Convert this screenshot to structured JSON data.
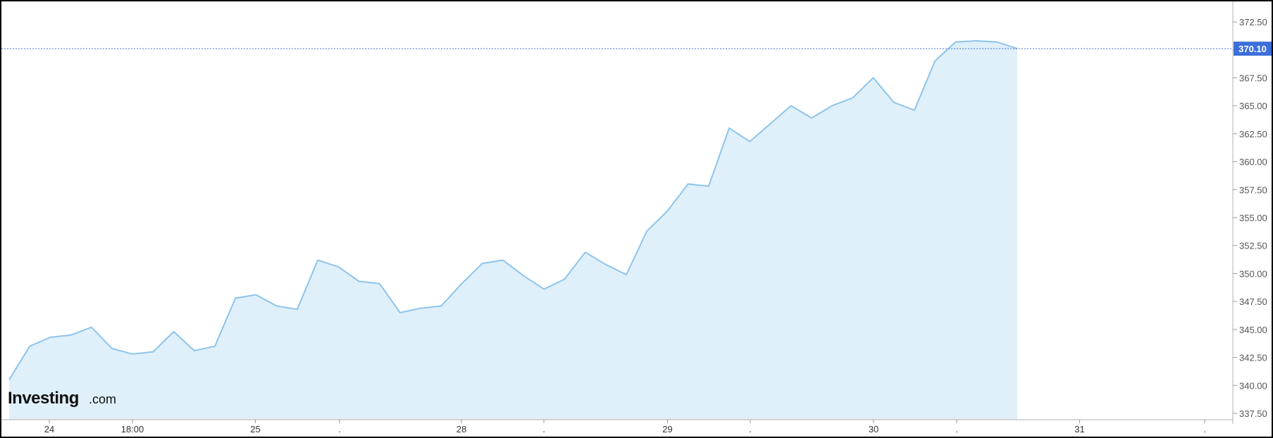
{
  "chart_data": {
    "type": "area",
    "line_color": "#8cc4ee",
    "fill_color": "#e0f0fa",
    "y_ticks": [
      "372.50",
      "370.00",
      "367.50",
      "365.00",
      "362.50",
      "360.00",
      "357.50",
      "355.00",
      "352.50",
      "350.00",
      "347.50",
      "345.00",
      "342.50",
      "340.00",
      "337.50"
    ],
    "ylim": [
      337.5,
      372.5
    ],
    "x_ticks": [
      "24",
      "18:00",
      "25",
      ".",
      "28",
      ".",
      "29",
      ".",
      "30",
      ".",
      "31",
      "."
    ],
    "current_price": {
      "label": "370.10",
      "value": 370.1,
      "badge_color": "#3d6fdb",
      "line_color": "#3d6fdb"
    },
    "values": [
      340.5,
      343.5,
      344.3,
      344.5,
      345.2,
      343.3,
      342.8,
      343.0,
      344.8,
      343.1,
      343.5,
      347.8,
      348.1,
      347.1,
      346.8,
      351.2,
      350.6,
      349.3,
      349.1,
      346.5,
      346.9,
      347.1,
      349.1,
      350.9,
      351.2,
      349.8,
      348.6,
      349.5,
      351.9,
      350.8,
      349.9,
      353.8,
      355.6,
      358.0,
      357.8,
      363.0,
      361.8,
      363.4,
      365.0,
      363.9,
      365.0,
      365.7,
      367.5,
      365.3,
      364.6,
      369.0,
      370.7,
      370.8,
      370.7,
      370.1
    ]
  },
  "watermark": {
    "brand": "Investing",
    "suffix": ".com"
  }
}
